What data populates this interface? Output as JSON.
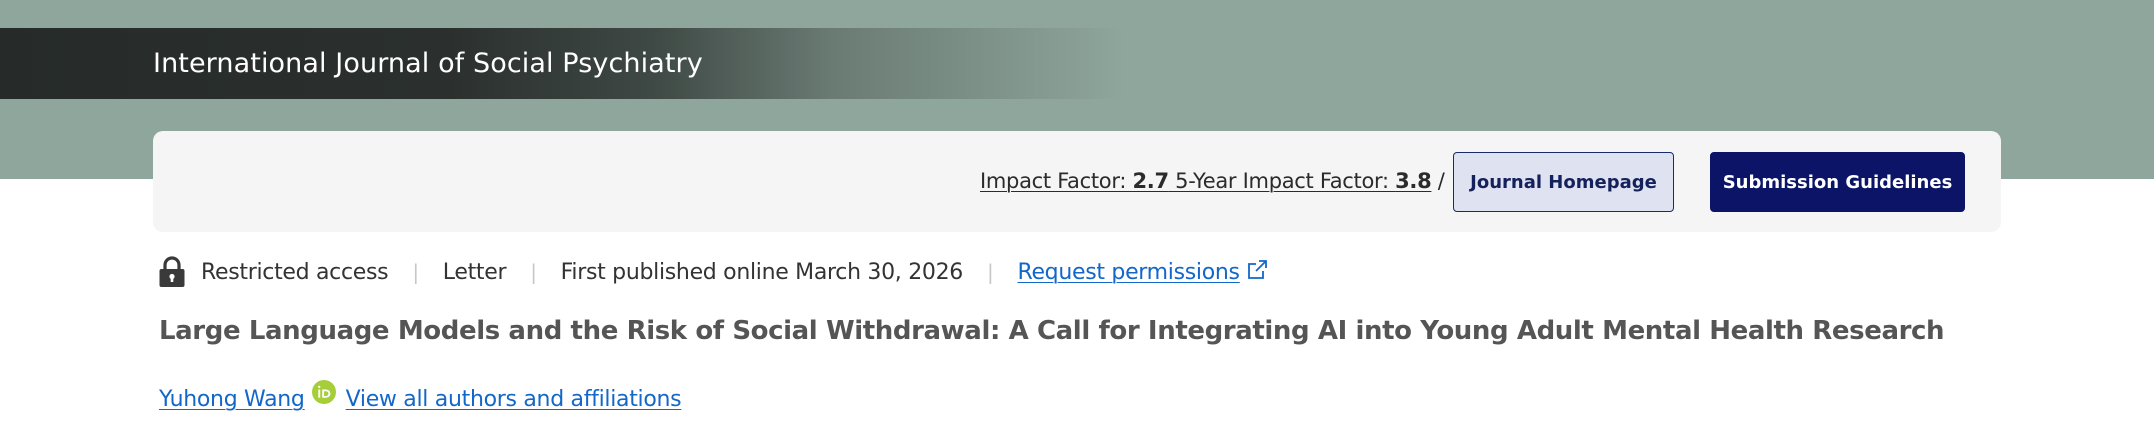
{
  "header": {
    "journal_title": "International Journal of Social Psychiatry"
  },
  "metrics": {
    "impact_factor_label": "Impact Factor: ",
    "impact_factor_value": "2.7",
    "five_year_label": " 5-Year Impact Factor: ",
    "five_year_value": "3.8",
    "trailing": " /"
  },
  "buttons": {
    "journal_homepage": "Journal Homepage",
    "submission_guidelines": "Submission Guidelines"
  },
  "meta": {
    "access": "Restricted access",
    "sep1": "|",
    "article_type": "Letter",
    "sep2": "|",
    "published": "First published online March 30, 2026",
    "sep3": "|",
    "permissions": "Request permissions"
  },
  "article": {
    "title": "Large Language Models and the Risk of Social Withdrawal: A Call for Integrating AI into Young Adult Mental Health Research"
  },
  "authors": {
    "author_name": "Yuhong Wang",
    "view_all": "View all authors and affiliations"
  },
  "colors": {
    "hero_bg": "#8fa69c",
    "journal_bar": "#262b29",
    "card_bg": "#f5f5f5",
    "link": "#1267c8",
    "primary_button": "#0b1466",
    "secondary_button_bg": "#dfe3f1",
    "orcid": "#a6ce39"
  },
  "icons": {
    "lock": "lock-icon",
    "external": "external-link-icon",
    "orcid": "orcid-icon"
  }
}
